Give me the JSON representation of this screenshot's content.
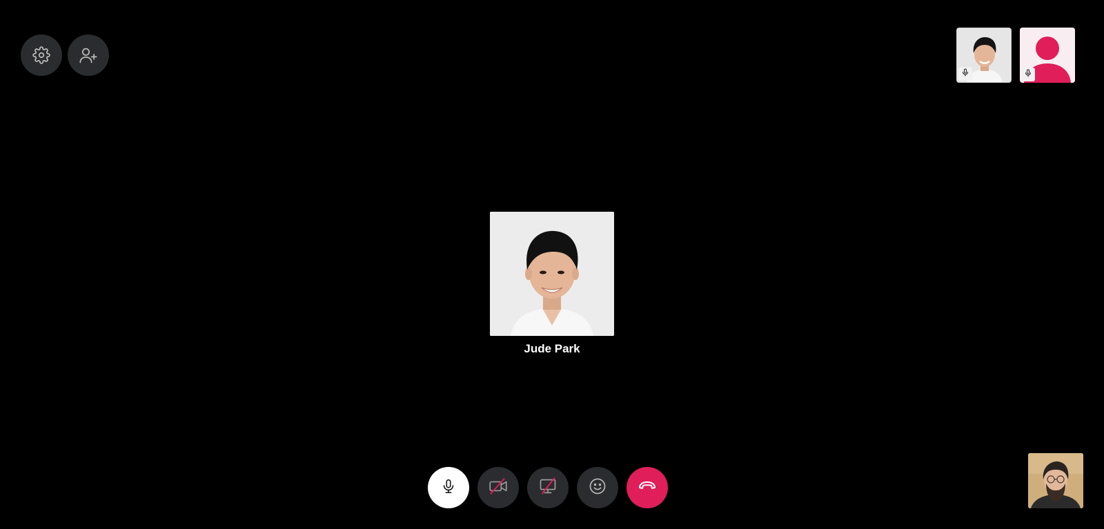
{
  "toolbar": {
    "settings_icon": "gear-icon",
    "add_people_icon": "add-user-icon"
  },
  "participants": [
    {
      "avatar": "person-photo",
      "mic_icon": "mic-icon"
    },
    {
      "avatar": "default-avatar-icon",
      "mic_icon": "mic-icon",
      "color": "#e01e5a"
    }
  ],
  "active_speaker": {
    "name": "Jude Park",
    "avatar": "person-photo"
  },
  "controls": {
    "mic_icon": "mic-icon",
    "camera_icon": "video-off-icon",
    "screen_share_icon": "screen-share-off-icon",
    "reaction_icon": "emoji-icon",
    "hangup_icon": "hangup-icon",
    "hangup_color": "#e01e5a"
  },
  "self_view": {
    "avatar": "person-photo"
  }
}
